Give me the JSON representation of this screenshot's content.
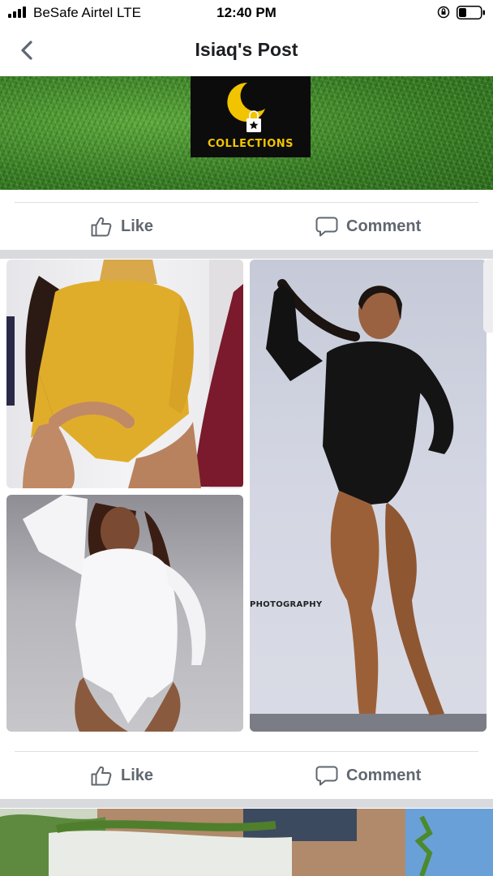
{
  "status_bar": {
    "carrier": "BeSafe Airtel  LTE",
    "time": "12:40 PM",
    "icons": [
      "signal-icon",
      "orientation-lock-icon",
      "battery-icon"
    ]
  },
  "nav": {
    "back_icon": "chevron-left-icon",
    "title": "Isiaq's Post"
  },
  "photos": [
    {
      "kind": "banner",
      "logo_text": "COLLECTIONS",
      "logo_icons": [
        "crescent-moon-icon",
        "shopping-bag-icon"
      ]
    },
    {
      "kind": "collage",
      "caption_text": "PHOTOGRAPHY",
      "items": [
        "yellow-bodysuit-photo",
        "white-bodysuit-photo",
        "black-bodysuit-photo"
      ]
    }
  ],
  "actions": {
    "like_label": "Like",
    "comment_label": "Comment",
    "like_icon": "thumbs-up-icon",
    "comment_icon": "comment-bubble-icon"
  },
  "colors": {
    "action_text": "#606770",
    "separator": "#d9dadd",
    "logo_gold": "#f2c400"
  }
}
